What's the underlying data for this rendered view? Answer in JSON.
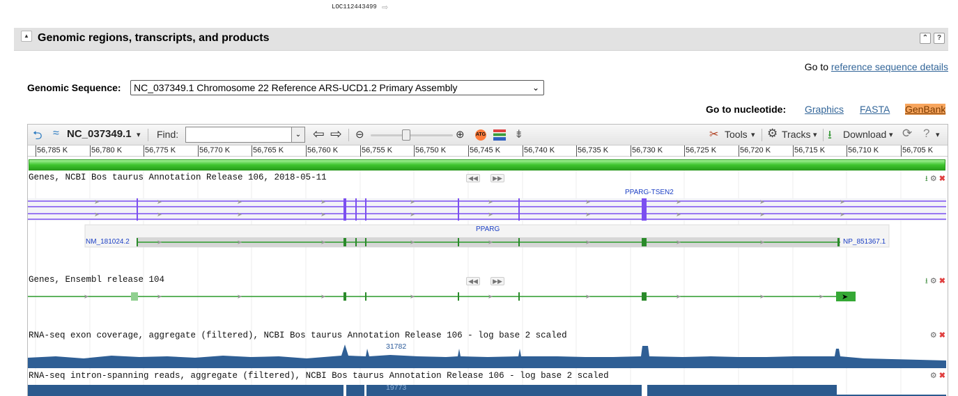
{
  "top_fragment": {
    "gene_name": "LOC112443499",
    "arrow": "⇨"
  },
  "section": {
    "title": "Genomic regions, transcripts, and products",
    "collapse_symbol": "▲",
    "btn_top": "⌃",
    "btn_help": "?"
  },
  "goto_reference": {
    "prefix": "Go to ",
    "link": "reference sequence details"
  },
  "genomic_sequence": {
    "label": "Genomic Sequence:",
    "selected": "NC_037349.1 Chromosome 22 Reference ARS-UCD1.2 Primary Assembly",
    "chevron": "⌄"
  },
  "goto_nucleotide": {
    "label": "Go to nucleotide:",
    "links": [
      "Graphics",
      "FASTA",
      "GenBank"
    ],
    "active": "GenBank"
  },
  "toolbar": {
    "sequence_id": "NC_037349.1",
    "find_label": "Find:",
    "find_value": "",
    "tools_label": "Tools",
    "tracks_label": "Tracks",
    "download_label": "Download",
    "help_symbol": "?",
    "dropdown_caret": "▾",
    "back_symbol": "⮌",
    "left_symbol": "⇦",
    "right_symbol": "⇨",
    "zoom_out_symbol": "⊖",
    "zoom_in_symbol": "⊕",
    "tools_symbol": "✂",
    "gear_symbol": "⚙",
    "download_symbol": "⭳",
    "refresh_symbol": "⟳"
  },
  "ruler_ticks": [
    "56,785 K",
    "56,780 K",
    "56,775 K",
    "56,770 K",
    "56,765 K",
    "56,760 K",
    "56,755 K",
    "56,750 K",
    "56,745 K",
    "56,740 K",
    "56,735 K",
    "56,730 K",
    "56,725 K",
    "56,720 K",
    "56,715 K",
    "56,710 K",
    "56,705 K"
  ],
  "tracks": {
    "ncbi_genes": {
      "label": "Genes, NCBI Bos taurus Annotation Release 106, 2018-05-11",
      "gene_top": "PPARG-TSEN2",
      "gene_main": "PPARG",
      "rna": "NM_181024.2",
      "protein": "NP_851367.1"
    },
    "ensembl_genes": {
      "label": "Genes, Ensembl release 104"
    },
    "rna_exon": {
      "label": "RNA-seq exon coverage, aggregate (filtered), NCBI Bos taurus Annotation Release 106 - log base 2 scaled",
      "max_value": "31782"
    },
    "rna_intron": {
      "label": "RNA-seq intron-spanning reads, aggregate (filtered), NCBI Bos taurus Annotation Release 106 - log base 2 scaled",
      "max_value": "19773"
    }
  },
  "track_controls": {
    "download": "⭳",
    "settings": "⚙",
    "close": "✖",
    "prev": "◀◀",
    "next": "▶▶"
  },
  "colors": {
    "section_bar": "#e2e2e2",
    "link": "#336699",
    "sequence_bar": "#3ec52e",
    "gene_purple": "#7b4ef0",
    "gene_green": "#2a9a2a",
    "coverage_blue": "#2f5f95",
    "active_link_bg": "#f7a55d"
  }
}
